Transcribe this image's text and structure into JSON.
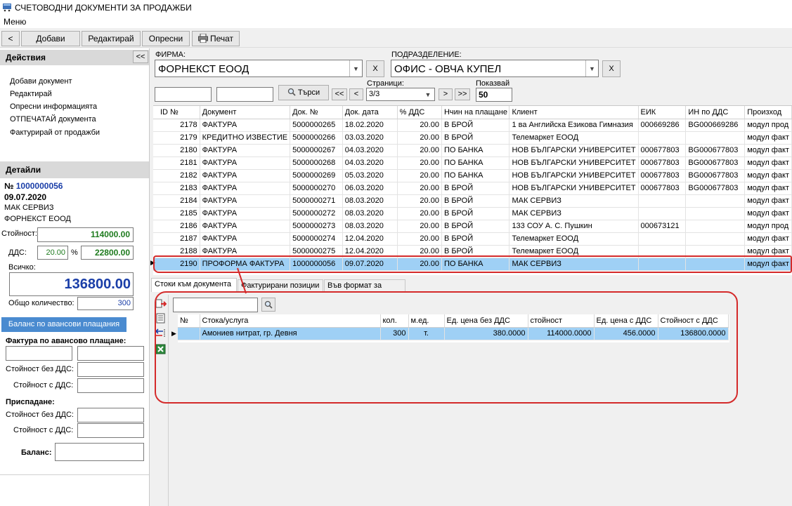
{
  "window": {
    "title": "СЧЕТОВОДНИ ДОКУМЕНТИ ЗА ПРОДАЖБИ",
    "menu": "Меню"
  },
  "toolbar": {
    "back": "<",
    "add": "Добави",
    "edit": "Редактирай",
    "refresh": "Опресни",
    "print": "Печат"
  },
  "actions": {
    "title": "Действия",
    "collapse": "<<",
    "items": [
      "Добави документ",
      "Редактирай",
      "Опресни информацията",
      "ОТПЕЧАТАЙ документа",
      "Фактурирай от продажби"
    ]
  },
  "details": {
    "title": "Детайли",
    "number_label": "№",
    "number": "1000000056",
    "date": "09.07.2020",
    "client": "МАК СЕРВИЗ",
    "firm": "ФОРНЕКСТ ЕООД",
    "value_label": "Стойност:",
    "value": "114000.00",
    "vat_label": "ДДС:",
    "vat_percent": "20.00",
    "percent_sign": "%",
    "vat_value": "22800.00",
    "total_label": "Всичко:",
    "total": "136800.00",
    "qty_label": "Общо количество:",
    "qty": "300",
    "advance_button": "Баланс по авансови плащания",
    "advance_invoice_label": "Фактура по авансово плащане:",
    "value_without_vat": "Стойност без ДДС:",
    "value_with_vat": "Стойност с ДДС:",
    "deduction_label": "Приспадане:",
    "balance_label": "Баланс:"
  },
  "filters": {
    "firm_label": "ФИРМА:",
    "firm_value": "ФОРНЕКСТ ЕООД",
    "dept_label": "ПОДРАЗДЕЛЕНИЕ:",
    "dept_value": "ОФИС - ОВЧА КУПЕЛ",
    "clear": "X",
    "search_button": "Търси",
    "first": "<<",
    "prev": "<",
    "next": ">",
    "last": ">>",
    "pages_label": "Страници:",
    "pages_value": "3/3",
    "show_label": "Показвай",
    "show_value": "50"
  },
  "grid": {
    "columns": [
      "ID №",
      "Документ",
      "Док. №",
      "Док. дата",
      "% ДДС",
      "Нчин на плащане",
      "Клиент",
      "ЕИК",
      "ИН по ДДС",
      "Произход"
    ],
    "rows": [
      [
        "2178",
        "ФАКТУРА",
        "5000000265",
        "18.02.2020",
        "20.00",
        "В БРОЙ",
        "1 ва Английска Езикова Гимназия",
        "000669286",
        "BG000669286",
        "модул прод"
      ],
      [
        "2179",
        "КРЕДИТНО ИЗВЕСТИЕ",
        "5000000266",
        "03.03.2020",
        "20.00",
        "В БРОЙ",
        "Телемаркет ЕООД",
        "",
        "",
        "модул факт"
      ],
      [
        "2180",
        "ФАКТУРА",
        "5000000267",
        "04.03.2020",
        "20.00",
        "ПО БАНКА",
        "НОВ БЪЛГАРСКИ УНИВЕРСИТЕТ",
        "000677803",
        "BG000677803",
        "модул факт"
      ],
      [
        "2181",
        "ФАКТУРА",
        "5000000268",
        "04.03.2020",
        "20.00",
        "ПО БАНКА",
        "НОВ БЪЛГАРСКИ УНИВЕРСИТЕТ",
        "000677803",
        "BG000677803",
        "модул факт"
      ],
      [
        "2182",
        "ФАКТУРА",
        "5000000269",
        "05.03.2020",
        "20.00",
        "ПО БАНКА",
        "НОВ БЪЛГАРСКИ УНИВЕРСИТЕТ",
        "000677803",
        "BG000677803",
        "модул факт"
      ],
      [
        "2183",
        "ФАКТУРА",
        "5000000270",
        "06.03.2020",
        "20.00",
        "В БРОЙ",
        "НОВ БЪЛГАРСКИ УНИВЕРСИТЕТ",
        "000677803",
        "BG000677803",
        "модул факт"
      ],
      [
        "2184",
        "ФАКТУРА",
        "5000000271",
        "08.03.2020",
        "20.00",
        "В БРОЙ",
        "МАК СЕРВИЗ",
        "",
        "",
        "модул факт"
      ],
      [
        "2185",
        "ФАКТУРА",
        "5000000272",
        "08.03.2020",
        "20.00",
        "В БРОЙ",
        "МАК СЕРВИЗ",
        "",
        "",
        "модул факт"
      ],
      [
        "2186",
        "ФАКТУРА",
        "5000000273",
        "08.03.2020",
        "20.00",
        "В БРОЙ",
        "133 СОУ А. С. Пушкин",
        "000673121",
        "",
        "модул прод"
      ],
      [
        "2187",
        "ФАКТУРА",
        "5000000274",
        "12.04.2020",
        "20.00",
        "В БРОЙ",
        "Телемаркет ЕООД",
        "",
        "",
        "модул факт"
      ],
      [
        "2188",
        "ФАКТУРА",
        "5000000275",
        "12.04.2020",
        "20.00",
        "В БРОЙ",
        "Телемаркет ЕООД",
        "",
        "",
        "модул факт"
      ],
      [
        "2190",
        "ПРОФОРМА ФАКТУРА",
        "1000000056",
        "09.07.2020",
        "20.00",
        "ПО БАНКА",
        "МАК СЕРВИЗ",
        "",
        "",
        "модул факт"
      ]
    ]
  },
  "tabs": [
    "Стоки към документа",
    "Фактурирани позиции",
    "Във формат за печат"
  ],
  "items_grid": {
    "columns": [
      "№",
      "Стока/услуга",
      "кол.",
      "м.ед.",
      "Ед. цена без ДДС",
      "стойност",
      "Ед. цена с ДДС",
      "Стойност с ДДС"
    ],
    "rows": [
      [
        "",
        "Амониев нитрат, гр. Девня",
        "300",
        "т.",
        "380.0000",
        "114000.0000",
        "456.0000",
        "136800.0000"
      ]
    ]
  }
}
